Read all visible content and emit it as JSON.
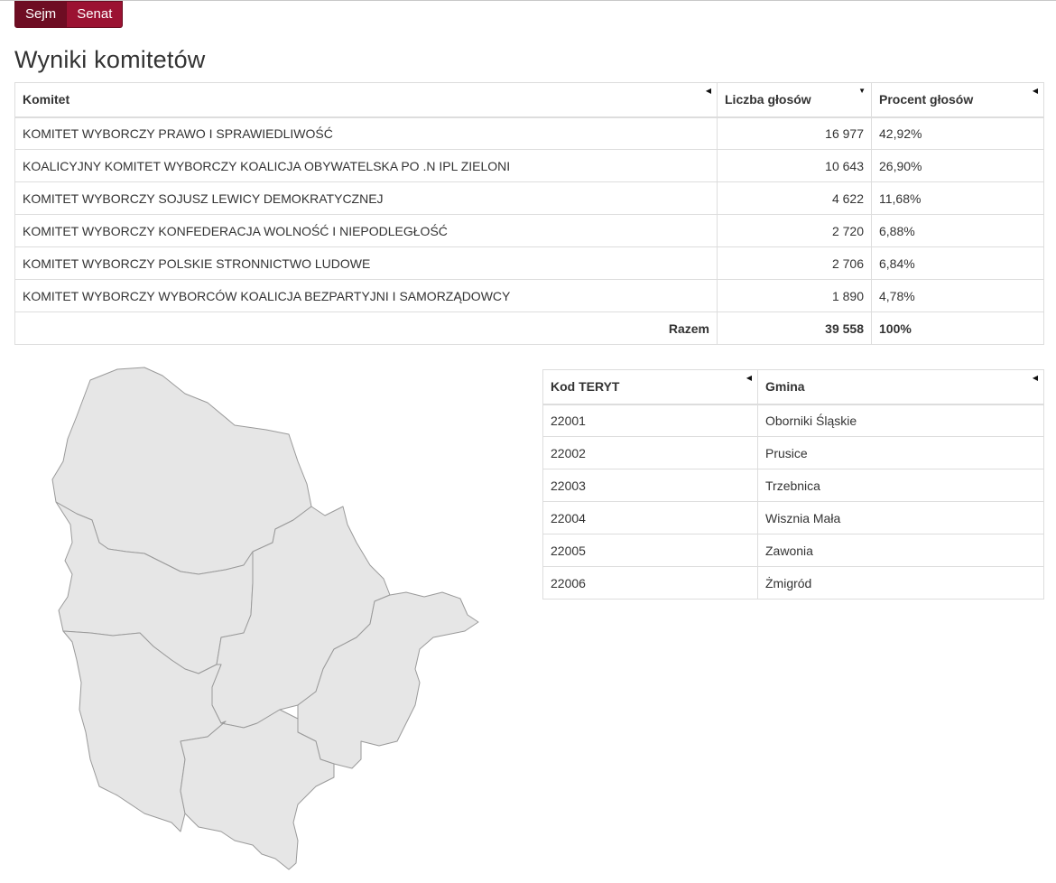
{
  "tabs": [
    {
      "label": "Sejm",
      "active": true
    },
    {
      "label": "Senat",
      "active": false
    }
  ],
  "title": "Wyniki komitetów",
  "results": {
    "headers": [
      "Komitet",
      "Liczba głosów",
      "Procent głosów"
    ],
    "rows": [
      {
        "komitet": "KOMITET WYBORCZY PRAWO I SPRAWIEDLIWOŚĆ",
        "glosy": "16 977",
        "procent": "42,92%"
      },
      {
        "komitet": "KOALICYJNY KOMITET WYBORCZY KOALICJA OBYWATELSKA PO .N IPL ZIELONI",
        "glosy": "10 643",
        "procent": "26,90%"
      },
      {
        "komitet": "KOMITET WYBORCZY SOJUSZ LEWICY DEMOKRATYCZNEJ",
        "glosy": "4 622",
        "procent": "11,68%"
      },
      {
        "komitet": "KOMITET WYBORCZY KONFEDERACJA WOLNOŚĆ I NIEPODLEGŁOŚĆ",
        "glosy": "2 720",
        "procent": "6,88%"
      },
      {
        "komitet": "KOMITET WYBORCZY POLSKIE STRONNICTWO LUDOWE",
        "glosy": "2 706",
        "procent": "6,84%"
      },
      {
        "komitet": "KOMITET WYBORCZY WYBORCÓW KOALICJA BEZPARTYJNI I SAMORZĄDOWCY",
        "glosy": "1 890",
        "procent": "4,78%"
      }
    ],
    "total": {
      "label": "Razem",
      "glosy": "39 558",
      "procent": "100%"
    }
  },
  "teryt": {
    "headers": [
      "Kod TERYT",
      "Gmina"
    ],
    "rows": [
      {
        "kod": "22001",
        "gmina": "Oborniki Śląskie"
      },
      {
        "kod": "22002",
        "gmina": "Prusice"
      },
      {
        "kod": "22003",
        "gmina": "Trzebnica"
      },
      {
        "kod": "22004",
        "gmina": "Wisznia Mała"
      },
      {
        "kod": "22005",
        "gmina": "Zawonia"
      },
      {
        "kod": "22006",
        "gmina": "Żmigród"
      }
    ]
  },
  "colors": {
    "tab_active": "#6e0d23",
    "tab_inactive": "#9b1232",
    "map_fill": "#e6e6e6",
    "map_stroke": "#9a9a9a"
  },
  "icons": {
    "sort_default": "sort-left-icon",
    "sort_desc": "sort-down-icon"
  }
}
